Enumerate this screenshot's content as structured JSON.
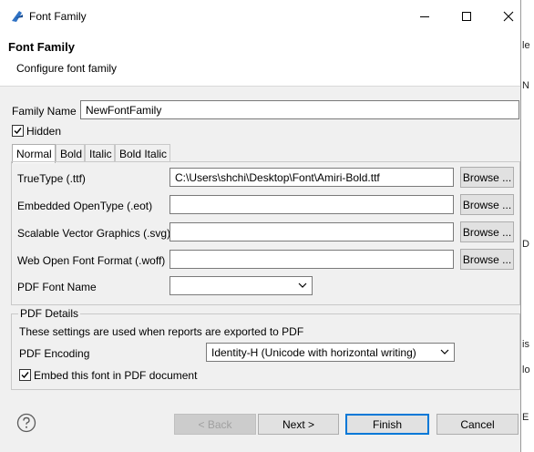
{
  "window": {
    "title": "Font Family"
  },
  "banner": {
    "title": "Font Family",
    "subtitle": "Configure font family"
  },
  "family_name": {
    "label": "Family Name",
    "value": "NewFontFamily"
  },
  "hidden": {
    "label": "Hidden",
    "checked": true
  },
  "tabs": [
    {
      "label": "Normal",
      "active": true
    },
    {
      "label": "Bold",
      "active": false
    },
    {
      "label": "Italic",
      "active": false
    },
    {
      "label": "Bold Italic",
      "active": false
    }
  ],
  "font_files": [
    {
      "label": "TrueType (.ttf)",
      "value": "C:\\Users\\shchi\\Desktop\\Font\\Amiri-Bold.ttf",
      "button": "Browse ..."
    },
    {
      "label": "Embedded OpenType (.eot)",
      "value": "",
      "button": "Browse ..."
    },
    {
      "label": "Scalable Vector Graphics (.svg)",
      "value": "",
      "button": "Browse ..."
    },
    {
      "label": "Web Open Font Format (.woff)",
      "value": "",
      "button": "Browse ..."
    }
  ],
  "pdf_font_name": {
    "label": "PDF Font Name",
    "value": ""
  },
  "pdf_details": {
    "legend": "PDF Details",
    "description": "These settings are used when reports are exported to PDF",
    "encoding_label": "PDF Encoding",
    "encoding_value": "Identity-H (Unicode with horizontal writing)",
    "embed_label": "Embed this font in PDF document",
    "embed_checked": true
  },
  "footer": {
    "back": "< Back",
    "next": "Next >",
    "finish": "Finish",
    "cancel": "Cancel"
  },
  "background_fragments": [
    "le",
    "N",
    "D",
    "is",
    "lo",
    "E"
  ],
  "colors": {
    "accent": "#0078d7",
    "dialog_bg": "#f0f0f0",
    "disabled_text": "#a0a0a0"
  }
}
